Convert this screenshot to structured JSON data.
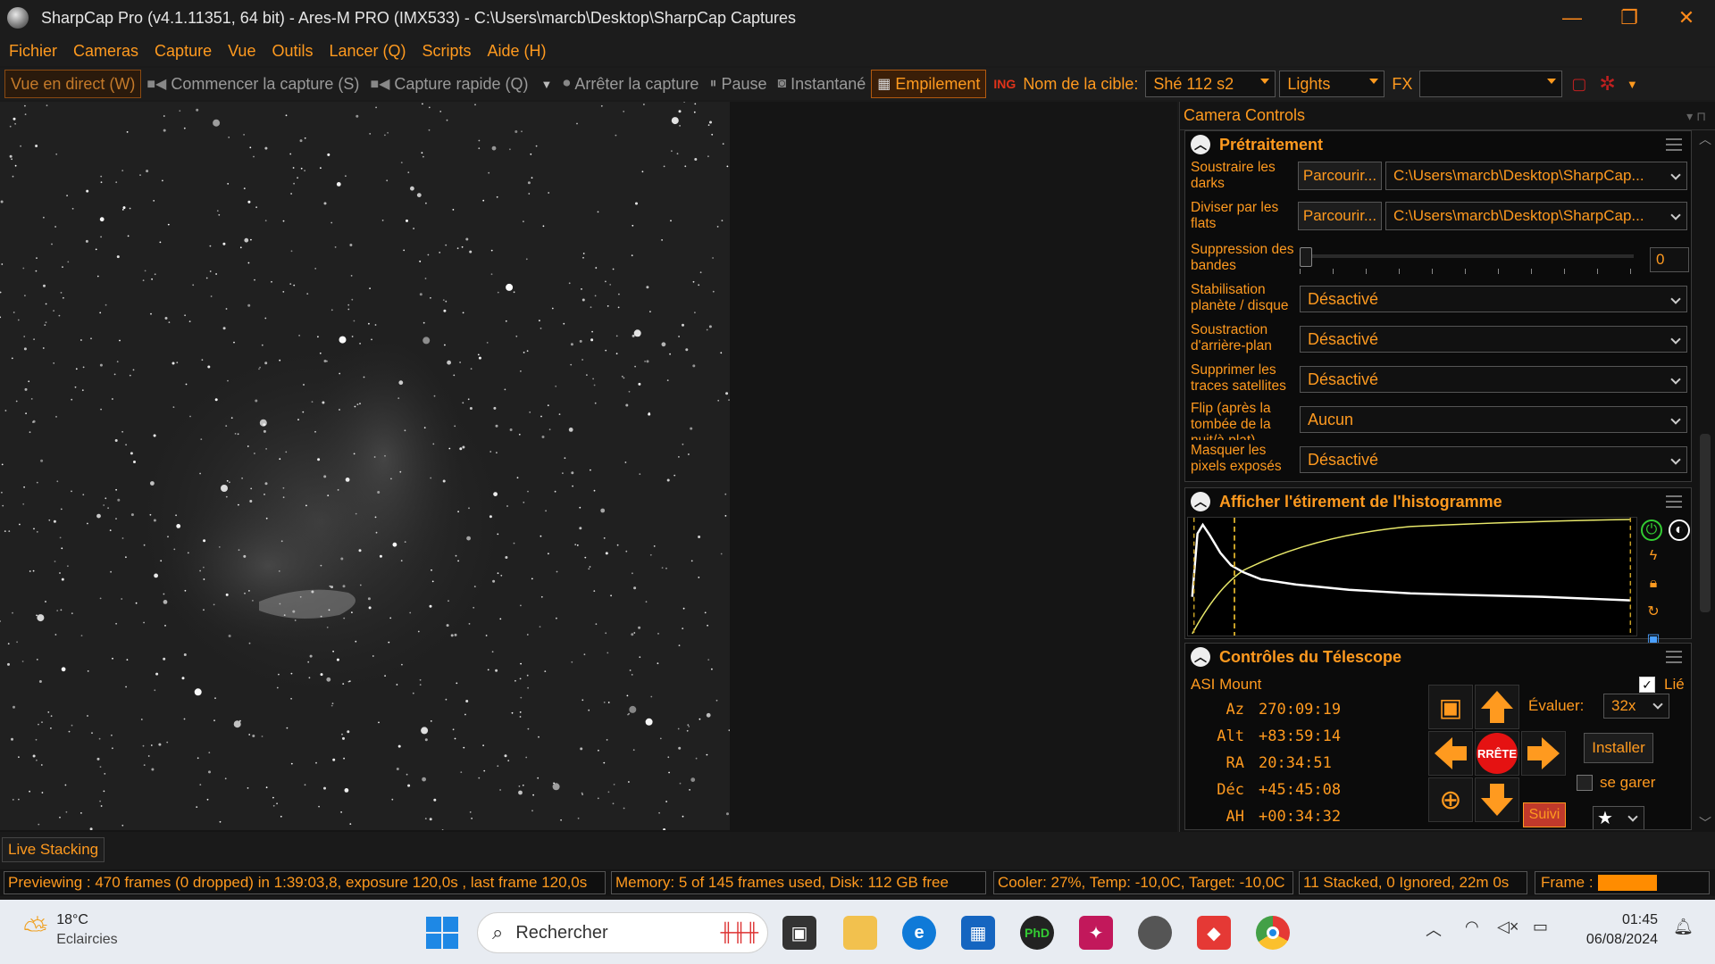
{
  "titlebar": {
    "title": "SharpCap Pro (v4.1.11351, 64 bit) - Ares-M PRO (IMX533) - C:\\Users\\marcb\\Desktop\\SharpCap Captures",
    "minimize": "—",
    "restore": "❐",
    "close": "✕"
  },
  "menu": [
    "Fichier",
    "Cameras",
    "Capture",
    "Vue",
    "Outils",
    "Lancer (Q)",
    "Scripts",
    "Aide (H)"
  ],
  "toolbar": {
    "live_view": "Vue en direct (W)",
    "start_capture": "Commencer la capture (S)",
    "quick_capture": "Capture rapide (Q)",
    "stop_capture": "Arrêter la capture",
    "pause": "Pause",
    "snapshot": "Instantané",
    "stacking": "Empilement",
    "target_label": "Nom de la cible:",
    "target_value": "Shé 112 s2",
    "frame_type": "Lights",
    "fx_label": "FX",
    "fx_value": ""
  },
  "panel": {
    "title": "Camera Controls",
    "preprocessing": {
      "title": "Prétraitement",
      "darks_label": "Soustraire les darks",
      "darks_button": "Parcourir...",
      "darks_path": "C:\\Users\\marcb\\Desktop\\SharpCap...",
      "flats_label": "Diviser par les flats",
      "flats_button": "Parcourir...",
      "flats_path": "C:\\Users\\marcb\\Desktop\\SharpCap...",
      "banding_label": "Suppression des bandes",
      "banding_value": "0",
      "banding_level": 0,
      "stab_label": "Stabilisation planète / disque",
      "stab_value": "Désactivé",
      "bg_label": "Soustraction d'arrière-plan",
      "bg_value": "Désactivé",
      "sat_label": "Supprimer les traces satellites",
      "sat_value": "Désactivé",
      "flip_label": "Flip (après la tombée de la nuit/à plat)",
      "flip_value": "Aucun",
      "mask_label": "Masquer les pixels exposés",
      "mask_value": "Désactivé"
    },
    "histogram": {
      "title": "Afficher l'étirement de l'histogramme"
    },
    "telescope": {
      "title": "Contrôles du Télescope",
      "mount": "ASI Mount",
      "linked_label": "Lié",
      "linked": true,
      "az_label": "Az",
      "az": "270:09:19",
      "alt_label": "Alt",
      "alt": "+83:59:14",
      "ra_label": "RA",
      "ra": "20:34:51",
      "dec_label": "Déc",
      "dec": "+45:45:08",
      "ah_label": "AH",
      "ah": "+00:34:32",
      "stop_label": "RRÊTE",
      "rate_label": "Évaluer:",
      "rate_value": "32x",
      "install_button": "Installer",
      "park_label": "se garer",
      "track_button": "Suivi"
    }
  },
  "live_stacking_tab": "Live Stacking",
  "status": {
    "preview": "Previewing : 470 frames (0 dropped) in 1:39:03,8, exposure 120,0s , last frame 120,0s",
    "memory": "Memory: 5 of 145 frames used, Disk: 112 GB free",
    "cooler": "Cooler: 27%, Temp: -10,0C, Target: -10,0C",
    "stacked": "11 Stacked, 0 Ignored, 22m 0s",
    "frame_label": "Frame :",
    "frame_progress": 0.55
  },
  "taskbar": {
    "temp": "18°C",
    "weather": "Eclaircies",
    "search_placeholder": "Rechercher",
    "time": "01:45",
    "date": "06/08/2024"
  },
  "colors": {
    "accent": "#ff9a1f",
    "background": "#1c1c1c",
    "stop_red": "#e51212"
  }
}
